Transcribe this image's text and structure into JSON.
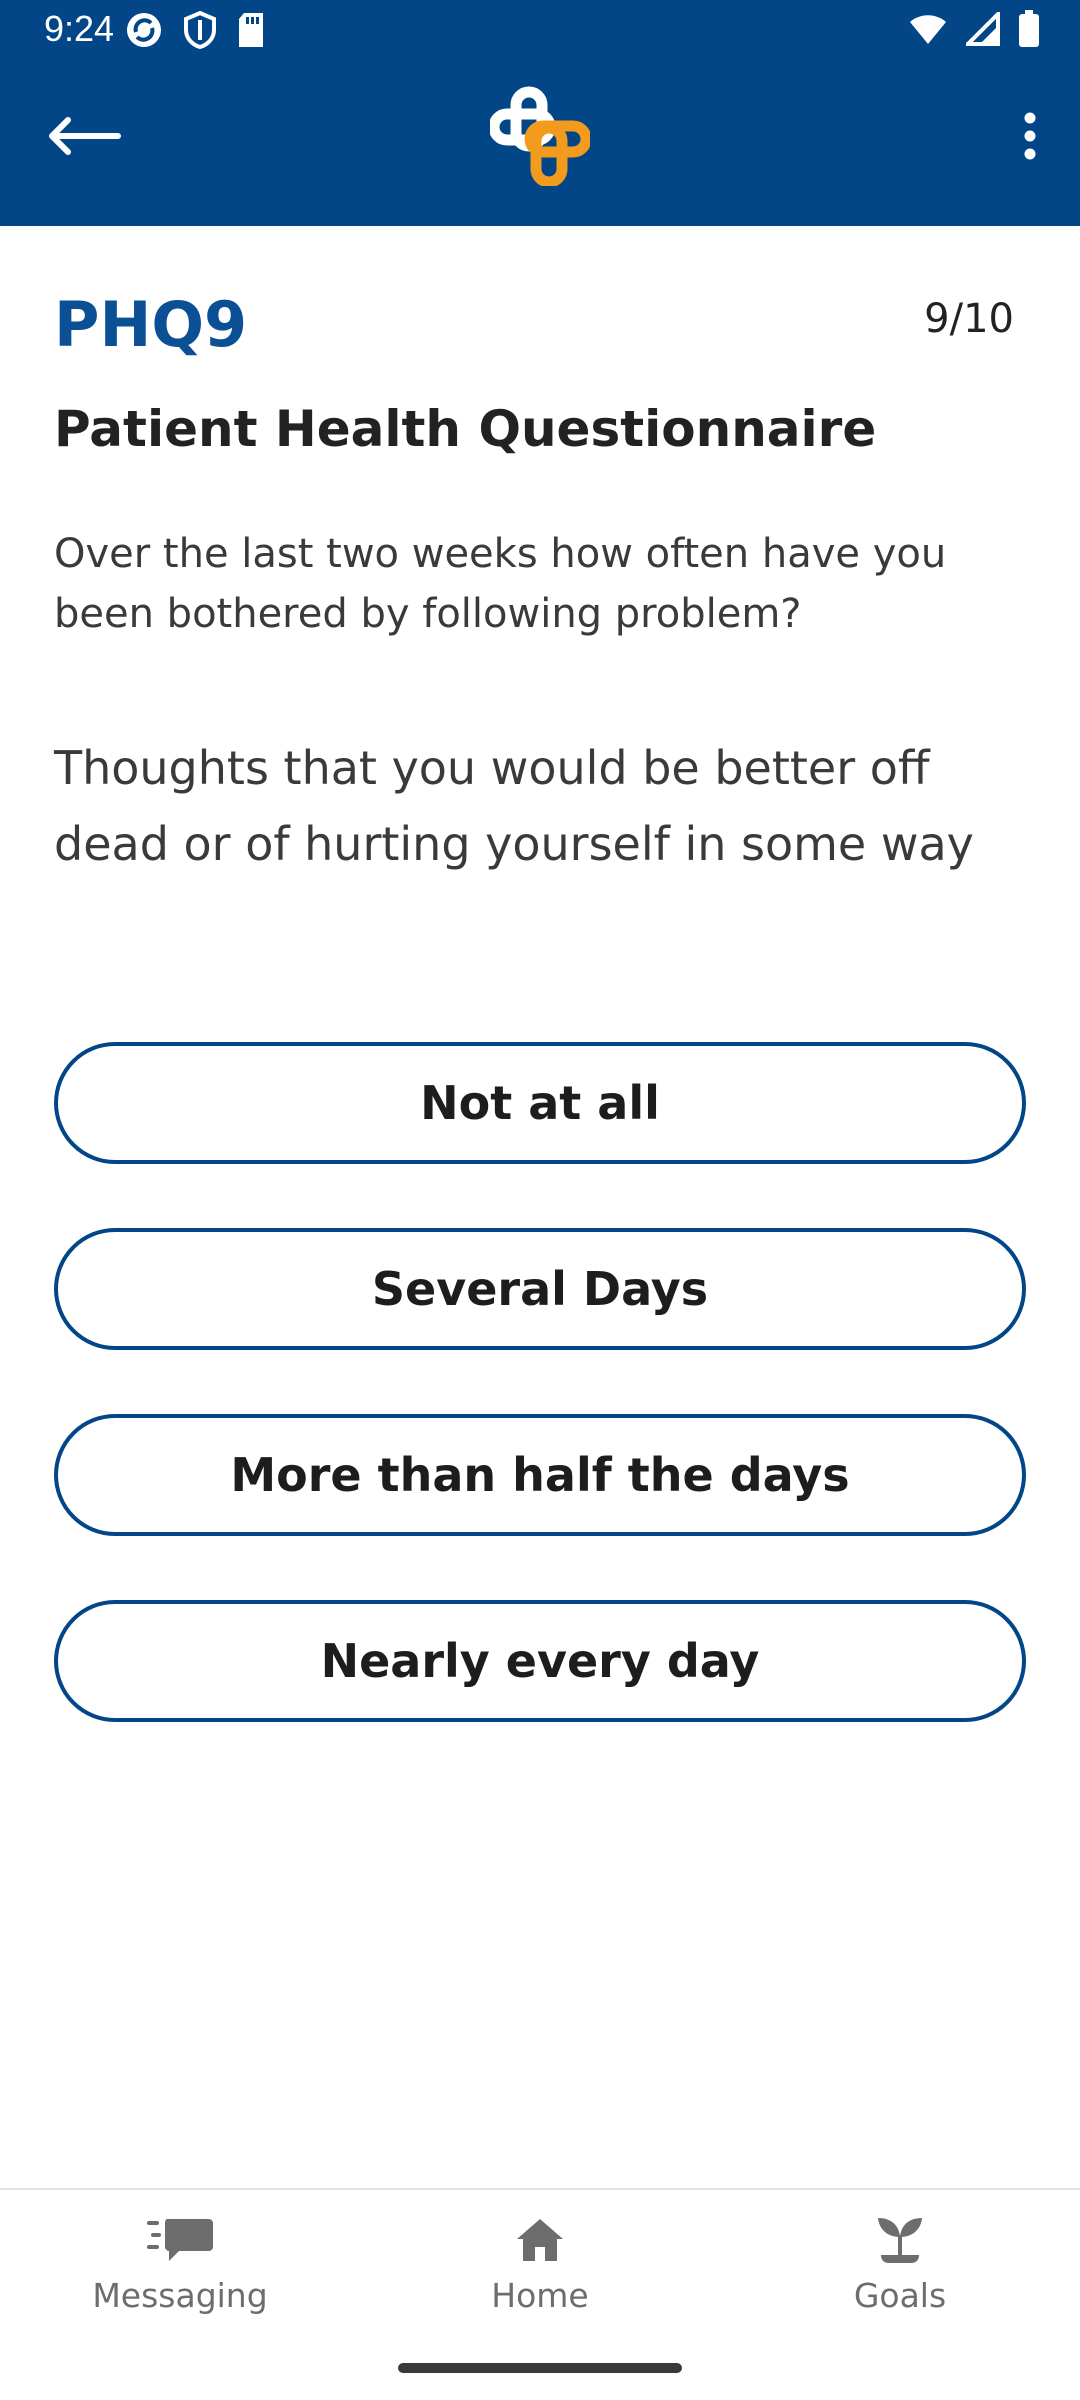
{
  "status_bar": {
    "time": "9:24",
    "icons": [
      "sync-icon",
      "shield-icon",
      "sd-card-icon",
      "wifi-icon",
      "signal-icon",
      "battery-icon"
    ]
  },
  "app_bar": {
    "back_icon": "arrow-left-icon",
    "logo": "cross-logo",
    "menu_icon": "more-vert-icon",
    "background_color": "#034687",
    "logo_colors": [
      "#ffffff",
      "#f29b1d"
    ]
  },
  "questionnaire": {
    "title": "PHQ9",
    "progress": "9/10",
    "subtitle": "Patient Health Questionnaire",
    "instruction": "Over the last two weeks how often have you been bothered by following problem?",
    "question": "Thoughts that you would be better off dead or of hurting yourself in some way",
    "options": [
      "Not at all",
      "Several Days",
      "More than half the days",
      "Nearly every day"
    ],
    "accent_color": "#034687"
  },
  "bottom_nav": {
    "items": [
      {
        "label": "Messaging",
        "icon": "chat-icon"
      },
      {
        "label": "Home",
        "icon": "home-icon"
      },
      {
        "label": "Goals",
        "icon": "sprout-icon"
      }
    ]
  }
}
